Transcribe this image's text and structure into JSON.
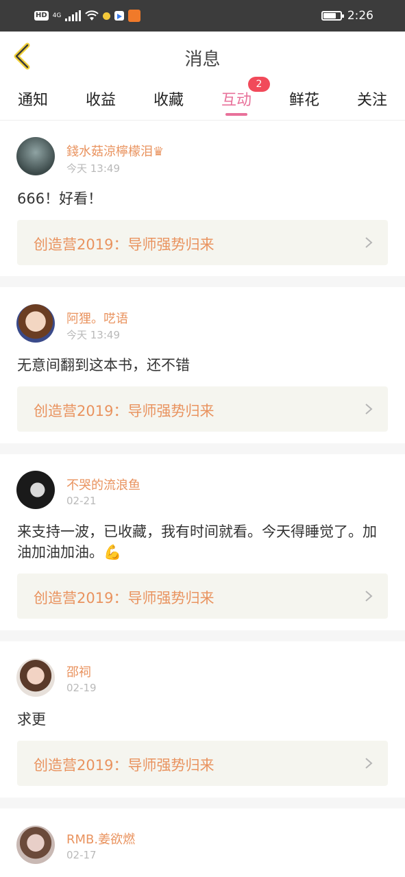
{
  "status_bar": {
    "hd": "HD",
    "network": "4G",
    "time": "2:26"
  },
  "header": {
    "title": "消息",
    "back_icon": "chevron-left-icon"
  },
  "tabs": [
    {
      "label": "通知"
    },
    {
      "label": "收益"
    },
    {
      "label": "收藏"
    },
    {
      "label": "互动",
      "active": true,
      "badge": "2"
    },
    {
      "label": "鲜花"
    },
    {
      "label": "关注"
    }
  ],
  "messages": [
    {
      "user": "錢水菇涼檸檬泪♛",
      "time": "今天 13:49",
      "content": "666！好看！",
      "book": "创造营2019：导师强势归来"
    },
    {
      "user": "阿狸。呓语",
      "time": "今天 13:49",
      "content": "无意间翻到这本书，还不错",
      "book": "创造营2019：导师强势归来"
    },
    {
      "user": "不哭的流浪鱼",
      "time": "02-21",
      "content": "来支持一波，已收藏，我有时间就看。今天得睡觉了。加油加油加油。💪",
      "book": "创造营2019：导师强势归来"
    },
    {
      "user": "邵祠",
      "time": "02-19",
      "content": "求更",
      "book": "创造营2019：导师强势归来"
    },
    {
      "user": "RMB.姜欲燃",
      "time": "02-17"
    }
  ],
  "colors": {
    "accent_pink": "#e8719a",
    "username_orange": "#e9935f",
    "badge_red": "#f14a5a",
    "card_bg": "#f5f5ef",
    "back_arrow": "#f2d23a"
  }
}
